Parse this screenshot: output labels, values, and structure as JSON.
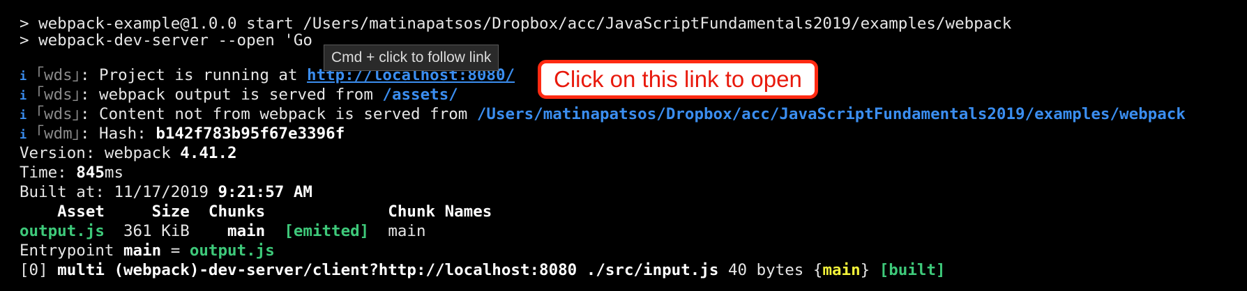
{
  "terminal": {
    "lines": {
      "l1": "> webpack-example@1.0.0 start /Users/matinapatsos/Dropbox/acc/JavaScriptFundamentals2019/examples/webpack",
      "l2": "> webpack-dev-server --open 'Go",
      "l3_icon": "i",
      "l3_tag": "｢wds｣",
      "l3_text": ": Project is running at ",
      "l3_url": "http://localhost:8080/",
      "l4_icon": "i",
      "l4_tag": "｢wds｣",
      "l4_text": ": webpack output is served from ",
      "l4_path": "/assets/",
      "l5_icon": "i",
      "l5_tag": "｢wds｣",
      "l5_text": ": Content not from webpack is served from ",
      "l5_path": "/Users/matinapatsos/Dropbox/acc/JavaScriptFundamentals2019/examples/webpack",
      "l6_icon": "i",
      "l6_tag": "｢wdm｣",
      "l6_text": ": Hash: ",
      "l6_hash": "b142f783b95f67e3396f",
      "l7_text": "Version: webpack ",
      "l7_version": "4.41.2",
      "l8_text": "Time: ",
      "l8_time": "845",
      "l8_unit": "ms",
      "l9_text": "Built at: 11/17/2019 ",
      "l9_time": "9:21:57 AM",
      "l10_header": "    Asset     Size  Chunks             Chunk Names",
      "l11_asset": "output.js",
      "l11_size": "  361 KiB    ",
      "l11_chunk": "main",
      "l11_status": "[emitted]",
      "l11_names": "  main",
      "l12_text": "Entrypoint ",
      "l12_name": "main",
      "l12_eq": " = ",
      "l12_file": "output.js",
      "l13_text": "[0] ",
      "l13_bold": "multi (webpack)-dev-server/client?http://localhost:8080 ./src/input.js",
      "l13_size": " 40 bytes {",
      "l13_chunk": "main",
      "l13_close": "} ",
      "l13_built": "[built]"
    }
  },
  "tooltip": {
    "text": "Cmd + click to follow link"
  },
  "callout": {
    "text": "Click on this link to open"
  },
  "colors": {
    "background": "#000000",
    "link": "#3b8ef0",
    "green": "#3ec97a",
    "yellow": "#f2f23a",
    "callout_border": "#ff2a12",
    "callout_text": "#e8190c"
  }
}
